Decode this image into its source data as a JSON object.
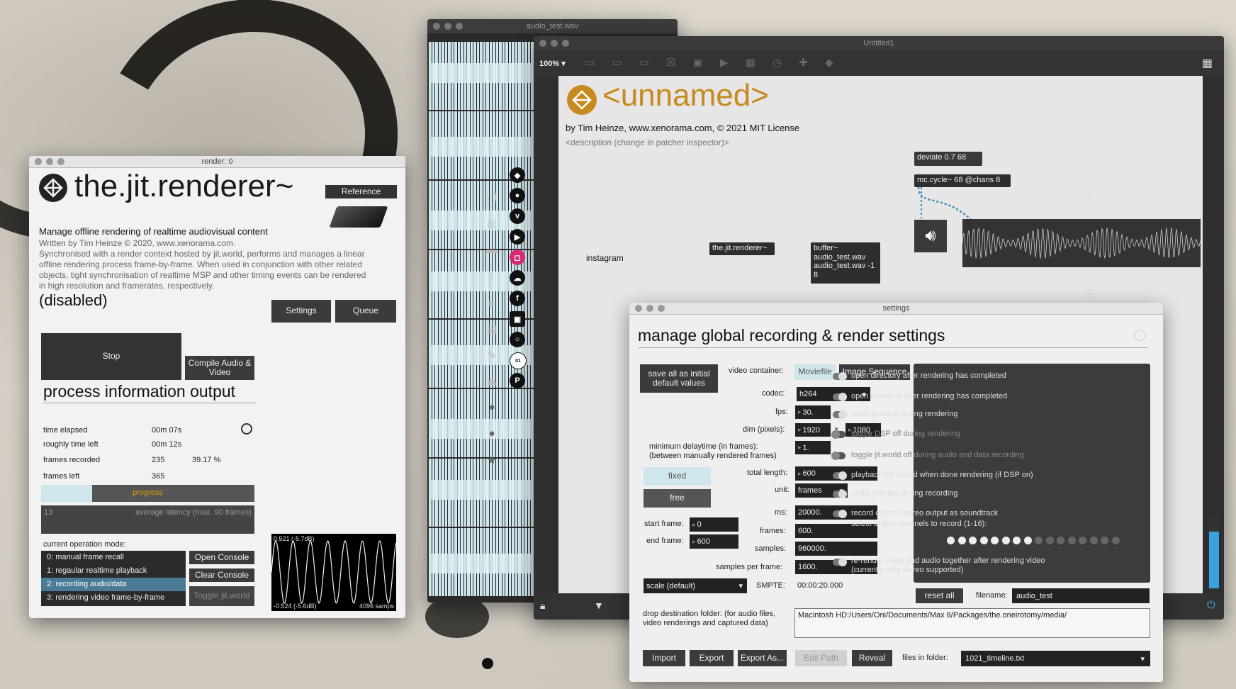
{
  "render_window": {
    "title": "render: 0",
    "name": "the.jit.renderer~",
    "reference_label": "Reference",
    "tagline": "Manage offline rendering of realtime audiovisual content",
    "credit": "Written by Tim Heinze © 2020, www.xenorama.com.",
    "description": "Synchronised with a render context hosted by jit.world, performs and manages a linear offline rendering process frame-by-frame. When used in conjunction with other related objects, tight synchronisation of realtime MSP and other timing events can be rendered in high resolution and framerates, respectively.",
    "status": "(disabled)",
    "settings_label": "Settings",
    "queue_label": "Queue",
    "stop_label": "Stop",
    "compile_label": "Compile Audio & Video",
    "section_title": "process information output",
    "info": [
      {
        "label": "time elapsed",
        "value": "00m 07s",
        "extra": ""
      },
      {
        "label": "roughly time left",
        "value": "00m 12s",
        "extra": ""
      },
      {
        "label": "frames recorded",
        "value": "235",
        "extra": "39.17 %"
      },
      {
        "label": "frames left",
        "value": "365",
        "extra": ""
      }
    ],
    "progress_label": "progress",
    "progress_fraction": 0.2392,
    "latency_value": "13",
    "latency_label": "average latency (max. 90 frames)",
    "mode_title": "current operation mode:",
    "modes": [
      "0: manual frame recall",
      "1: regaular realtime playback",
      "2: recording audio/data",
      "3: rendering video frame-by-frame"
    ],
    "selected_mode": 2,
    "open_console_label": "Open Console",
    "clear_console_label": "Clear Console",
    "toggle_world_label": "Toggle jit.world",
    "scope_top": "0.521 (-5.7dB)",
    "scope_bottom": "-0.524 (-5.6dB)",
    "scope_samps": "4096 samps"
  },
  "audio_window": {
    "title": "audio_test.wav"
  },
  "patcher": {
    "title": "Untitled1",
    "zoom": "100%",
    "name": "<unnamed>",
    "byline": "by Tim Heinze, www.xenorama.com, © 2021 MIT License",
    "description": "<description (change in patcher inspector)>",
    "instagram_label": "instagram",
    "obj_renderer": "the.jit.renderer~",
    "obj_buffer": "buffer~ audio_test.wav audio_test.wav -1 8",
    "obj_deviate": "deviate 0.7 68",
    "obj_cycle": "mc.cycle~ 68 @chans 8"
  },
  "settings_window": {
    "title": "settings",
    "heading": "manage global recording & render settings",
    "save_label": "save all as initial default values",
    "container_label": "video container:",
    "container_options": [
      "Moviefile",
      "Image Sequence"
    ],
    "container_selected": 1,
    "codec_label": "codec:",
    "codec_value": "h264",
    "fps_label": "fps:",
    "fps_value": "30.",
    "dim_label": "dim (pixels):",
    "dim_w": "1920",
    "dim_x": "×",
    "dim_h": "1080",
    "delay_label": "minimum delaytime (in frames): (between manually rendered frames)",
    "delay_value": "1.",
    "fixed_label": "fixed",
    "free_label": "free",
    "total_label": "total length:",
    "total_value": "600",
    "unit_label": "unit:",
    "unit_value": "frames",
    "ms_label": "ms:",
    "ms_value": "20000.",
    "frames_label": "frames:",
    "frames_value": "600.",
    "samples_label": "samples:",
    "samples_value": "960000.",
    "spf_label": "samples per frame:",
    "spf_value": "1600.",
    "start_label": "start frame:",
    "start_value": "0",
    "end_label": "end frame:",
    "end_value": "600",
    "scale_value": "scale (default)",
    "smpte_label": "SMPTE:",
    "smpte_value": "00:00:20.000",
    "toggles": [
      {
        "label": "open directory after rendering has completed",
        "on": true
      },
      {
        "label": "open moviefile after rendering has completed",
        "on": true
      },
      {
        "label": "video preview during rendering",
        "on": true
      },
      {
        "label": "toggle DSP off during rendering",
        "on": false
      },
      {
        "label": "toggle jit.world off during audio and data recording",
        "on": false
      },
      {
        "label": "playback AE sound when done rendering (if DSP on)",
        "on": true
      },
      {
        "label": "audio preview during recording",
        "on": true
      },
      {
        "label": "record current stereo output as soundtrack",
        "on": true
      }
    ],
    "channels_label": "select output channels to record (1-16):",
    "channels_on": 8,
    "rerender_label": "re-render video and audio together after rendering video (currently only stereo supported)",
    "reset_label": "reset all",
    "filename_label": "filename:",
    "filename_value": "audio_test",
    "drop_label": "drop destination folder: (for audio files, video renderings and captured data)",
    "path_value": "Macintosh HD:/Users/Oni/Documents/Max 8/Packages/the.oneirotomy/media/",
    "import_label": "Import",
    "export_label": "Export",
    "export_as_label": "Export As...",
    "edit_path_label": "Edit Path",
    "reveal_label": "Reveal",
    "files_label": "files in folder:",
    "files_value": "1021_timeline.txt"
  }
}
